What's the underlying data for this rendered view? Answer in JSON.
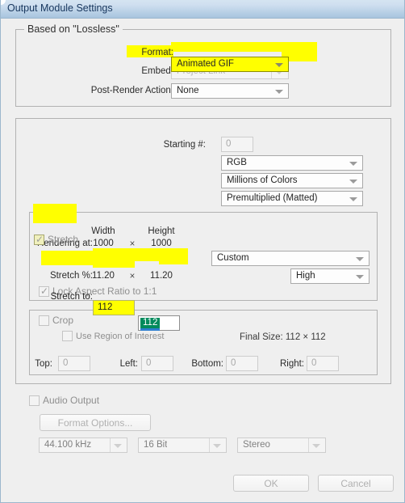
{
  "window": {
    "title": "Output Module Settings",
    "accent_title_color": "#17365d",
    "bg_color": "#efefef",
    "border_color": "#9cb7cd",
    "highlight_color": "#ffff00",
    "selection_color": "#008a5c"
  },
  "based_on_group": {
    "legend": "Based on \"Lossless\"",
    "rows": [
      {
        "label": "Format:",
        "value": "Animated GIF",
        "disabled": false,
        "highlighted": true
      },
      {
        "label": "Embed:",
        "value": "Project Link",
        "disabled": true,
        "highlighted": false
      },
      {
        "label": "Post-Render Action:",
        "value": "None",
        "disabled": false,
        "highlighted": false
      }
    ]
  },
  "video_group": {
    "starting_number": {
      "label": "Starting #:",
      "value": "0"
    },
    "channels": "RGB",
    "depth": "Millions of Colors",
    "color": "Premultiplied (Matted)"
  },
  "stretch_group": {
    "legend": "Stretch",
    "checked": true,
    "highlighted": true,
    "col_headers": {
      "width": "Width",
      "height": "Height"
    },
    "rendering_at": {
      "label": "Rendering at:",
      "width": "1000",
      "height": "1000",
      "times": "×"
    },
    "stretch_to": {
      "label": "Stretch to:",
      "width": "112",
      "height": "112",
      "height_selected": true,
      "highlighted": true
    },
    "stretch_pct": {
      "label": "Stretch %:",
      "width": "11.20",
      "height": "11.20",
      "times": "×"
    },
    "lock_aspect": {
      "label": "Lock Aspect Ratio to 1:1",
      "checked": true
    },
    "preset": "Custom",
    "quality": "High"
  },
  "crop_group": {
    "crop": {
      "label": "Crop",
      "checked": false
    },
    "use_region_of_interest": {
      "label": "Use Region of Interest",
      "checked": false
    },
    "final_size": "Final Size: 112 × 112",
    "edges": [
      {
        "label": "Top:",
        "value": "0"
      },
      {
        "label": "Left:",
        "value": "0"
      },
      {
        "label": "Bottom:",
        "value": "0"
      },
      {
        "label": "Right:",
        "value": "0"
      }
    ]
  },
  "audio_group": {
    "audio_output": {
      "label": "Audio Output",
      "checked": false
    },
    "format_options_button": "Format Options...",
    "sample_rate": "44.100 kHz",
    "bit_depth": "16 Bit",
    "channels": "Stereo"
  },
  "footer": {
    "ok_label": "OK",
    "cancel_label": "Cancel"
  }
}
